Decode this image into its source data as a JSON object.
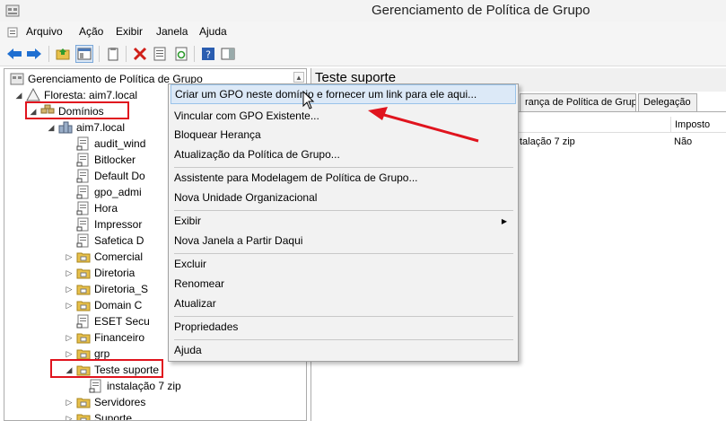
{
  "window": {
    "title": "Gerenciamento de Política de Grupo"
  },
  "menu": [
    "Arquivo",
    "Ação",
    "Exibir",
    "Janela",
    "Ajuda"
  ],
  "tree": {
    "root": "Gerenciamento de Política de Grupo",
    "forest": "Floresta: aim7.local",
    "domains": "Domínios",
    "domain": "aim7.local",
    "items": [
      "audit_wind",
      "Bitlocker",
      "Default Do",
      "gpo_admi",
      "Hora",
      "Impressor",
      "Safetica D",
      "Comercial",
      "Diretoria",
      "Diretoria_S",
      "Domain C",
      "ESET Secu",
      "Financeiro",
      "grp",
      "Teste suporte",
      "instalação 7 zip",
      "Servidores",
      "Suporte"
    ]
  },
  "right": {
    "title": "Teste suporte",
    "tabs": [
      "rança de Política de Grupo",
      "Delegação"
    ],
    "columns": [
      "Imposto"
    ],
    "row": {
      "name": "talação 7 zip",
      "enforced": "Não"
    }
  },
  "context_menu": {
    "items": [
      "Criar um GPO neste domínio e fornecer um link para ele aqui...",
      "Vincular com GPO Existente...",
      "Bloquear Herança",
      "Atualização da Política de Grupo...",
      "Assistente para Modelagem de Política de Grupo...",
      "Nova Unidade Organizacional",
      "Exibir",
      "Nova Janela a Partir Daqui",
      "Excluir",
      "Renomear",
      "Atualizar",
      "Propriedades",
      "Ajuda"
    ]
  },
  "colors": {
    "highlight": "#dce9f7",
    "annotation": "#e0141e"
  }
}
